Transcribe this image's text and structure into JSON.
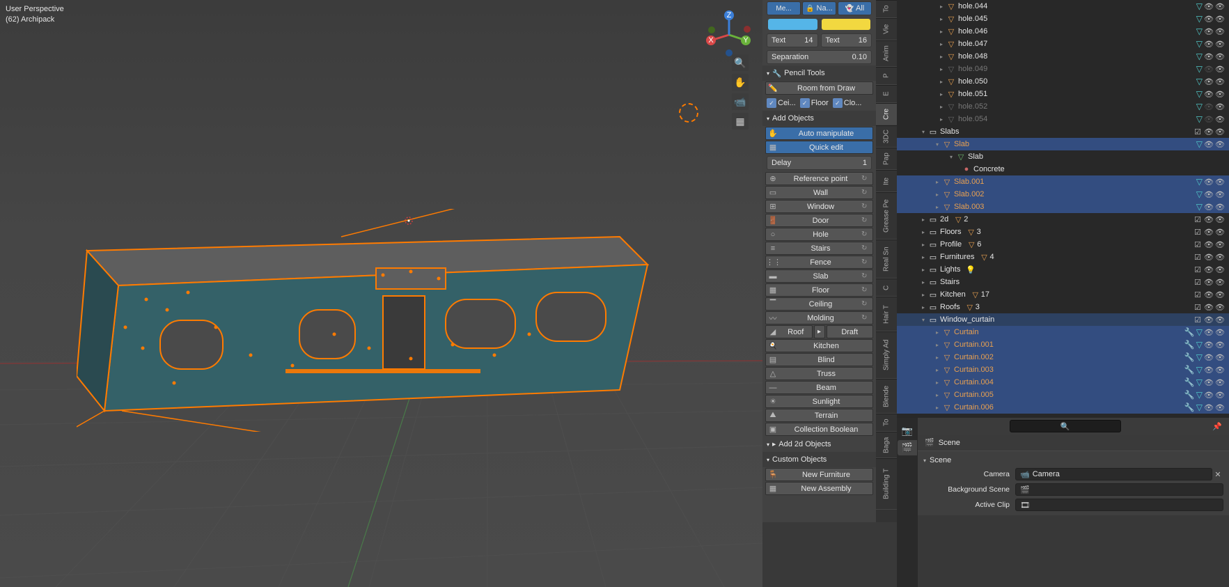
{
  "viewport": {
    "title": "User Perspective",
    "subtitle": "(62) Archipack"
  },
  "gizmo": {
    "x": "X",
    "y": "Y",
    "z": "Z"
  },
  "npanel": {
    "top_buttons": {
      "me": "Me...",
      "na": "Na...",
      "all": "All"
    },
    "text_a": {
      "label": "Text",
      "val": "14"
    },
    "text_b": {
      "label": "Text",
      "val": "16"
    },
    "separation": {
      "label": "Separation",
      "val": "0.10"
    },
    "pencil_section": "Pencil Tools",
    "room_from_draw": "Room from Draw",
    "chk_cei": "Cei...",
    "chk_floor": "Floor",
    "chk_clo": "Clo...",
    "add_objects": "Add Objects",
    "auto_manipulate": "Auto manipulate",
    "quick_edit": "Quick edit",
    "delay": {
      "label": "Delay",
      "val": "1"
    },
    "objects": [
      "Reference point",
      "Wall",
      "Window",
      "Door",
      "Hole",
      "Stairs",
      "Fence",
      "Slab",
      "Floor",
      "Ceiling",
      "Molding"
    ],
    "roof": "Roof",
    "draft": "Draft",
    "objects2": [
      "Kitchen",
      "Blind",
      "Truss",
      "Beam",
      "Sunlight",
      "Terrain",
      "Collection Boolean"
    ],
    "add_2d": "Add 2d Objects",
    "custom": "Custom Objects",
    "new_furniture": "New Furniture",
    "new_assembly": "New Assembly"
  },
  "np_tabs": [
    "To",
    "Vie",
    "Anim",
    "P",
    "E",
    "Cre",
    "3DC",
    "Pap",
    "Ite",
    "Grease Pe",
    "Real Sn",
    "C",
    "Hair T",
    "Simply Ad",
    "Blende",
    "To",
    "Baga",
    "Building T"
  ],
  "outliner": {
    "holes": [
      {
        "name": "hole.044",
        "dim": false
      },
      {
        "name": "hole.045",
        "dim": false
      },
      {
        "name": "hole.046",
        "dim": false
      },
      {
        "name": "hole.047",
        "dim": false
      },
      {
        "name": "hole.048",
        "dim": false
      },
      {
        "name": "hole.049",
        "dim": true
      },
      {
        "name": "hole.050",
        "dim": false
      },
      {
        "name": "hole.051",
        "dim": false
      },
      {
        "name": "hole.052",
        "dim": true
      },
      {
        "name": "hole.054",
        "dim": true
      }
    ],
    "slabs_coll": "Slabs",
    "slab": "Slab",
    "slab_nested": "Slab",
    "concrete": "Concrete",
    "slab_items": [
      "Slab.001",
      "Slab.002",
      "Slab.003"
    ],
    "collections": [
      {
        "name": "2d",
        "count": "2"
      },
      {
        "name": "Floors",
        "count": "3"
      },
      {
        "name": "Profile",
        "count": "6"
      },
      {
        "name": "Furnitures",
        "count": "4"
      },
      {
        "name": "Lights",
        "count": ""
      },
      {
        "name": "Stairs",
        "count": ""
      },
      {
        "name": "Kitchen",
        "count": "17"
      },
      {
        "name": "Roofs",
        "count": "3"
      }
    ],
    "window_curtain": "Window_curtain",
    "curtain": "Curtain",
    "curtains": [
      "Curtain.001",
      "Curtain.002",
      "Curtain.003",
      "Curtain.004",
      "Curtain.005",
      "Curtain.006"
    ]
  },
  "properties": {
    "scene_path": "Scene",
    "scene_section": "Scene",
    "camera_label": "Camera",
    "camera_value": "Camera",
    "bg_scene": "Background Scene",
    "active_clip": "Active Clip"
  }
}
